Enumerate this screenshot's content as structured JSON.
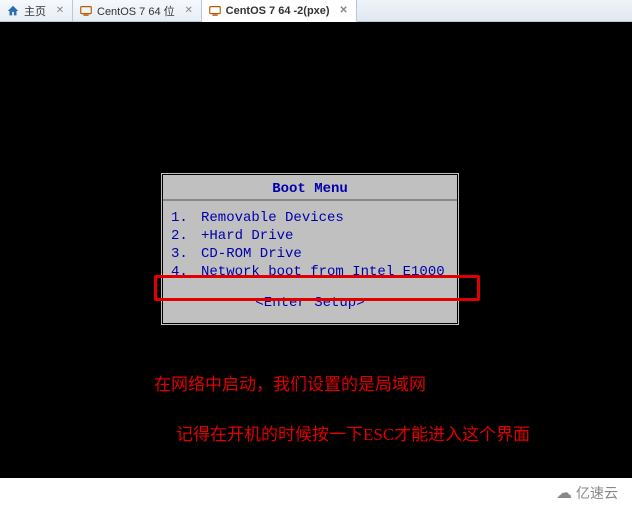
{
  "tabs": [
    {
      "label": "主页",
      "icon": "home"
    },
    {
      "label": "CentOS 7 64 位",
      "icon": "vm"
    },
    {
      "label": "CentOS 7 64  -2(pxe)",
      "icon": "vm",
      "active": true
    }
  ],
  "bios": {
    "title": "Boot Menu",
    "items": [
      {
        "num": "1.",
        "label": "Removable Devices"
      },
      {
        "num": "2.",
        "label": "+Hard Drive"
      },
      {
        "num": "3.",
        "label": "CD-ROM Drive"
      },
      {
        "num": "4.",
        "label": "Network boot from Intel E1000"
      }
    ],
    "enter_setup": "<Enter Setup>",
    "selected_index": 3
  },
  "annotations": {
    "line1": "在网络中启动，我们设置的是局域网",
    "line2": "记得在开机的时候按一下ESC才能进入这个界面"
  },
  "watermark": "亿速云"
}
